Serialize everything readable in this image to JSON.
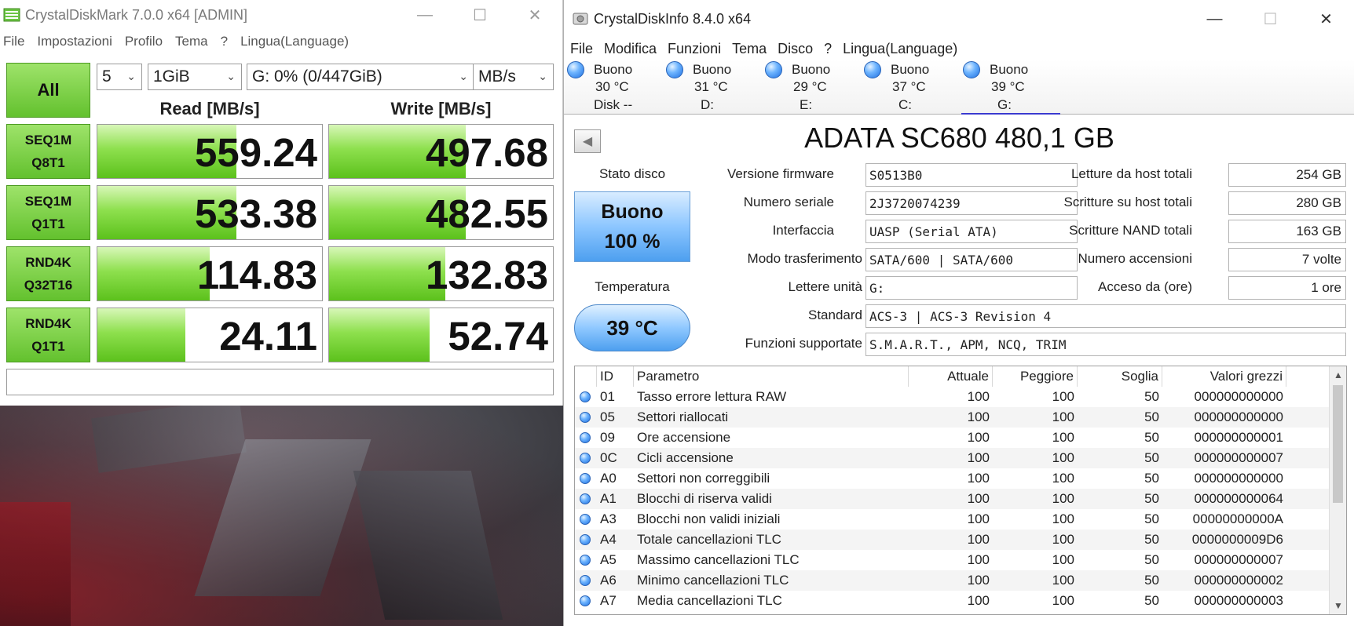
{
  "cdm": {
    "title": "CrystalDiskMark 7.0.0 x64 [ADMIN]",
    "menu": [
      "File",
      "Impostazioni",
      "Profilo",
      "Tema",
      "?",
      "Lingua(Language)"
    ],
    "all_label": "All",
    "count": "5",
    "size": "1GiB",
    "drive": "G: 0% (0/447GiB)",
    "unit": "MB/s",
    "read_header": "Read [MB/s]",
    "write_header": "Write [MB/s]",
    "tests": [
      {
        "l1": "SEQ1M",
        "l2": "Q8T1",
        "read": "559.24",
        "write": "497.68",
        "read_fill": 0.62,
        "write_fill": 0.61
      },
      {
        "l1": "SEQ1M",
        "l2": "Q1T1",
        "read": "533.38",
        "write": "482.55",
        "read_fill": 0.62,
        "write_fill": 0.61
      },
      {
        "l1": "RND4K",
        "l2": "Q32T16",
        "read": "114.83",
        "write": "132.83",
        "read_fill": 0.5,
        "write_fill": 0.52
      },
      {
        "l1": "RND4K",
        "l2": "Q1T1",
        "read": "24.11",
        "write": "52.74",
        "read_fill": 0.39,
        "write_fill": 0.45
      }
    ]
  },
  "cdi": {
    "title": "CrystalDiskInfo 8.4.0 x64",
    "menu": [
      "File",
      "Modifica",
      "Funzioni",
      "Tema",
      "Disco",
      "?",
      "Lingua(Language)"
    ],
    "disks": [
      {
        "status": "Buono",
        "temp": "30 °C",
        "letter": "Disk --"
      },
      {
        "status": "Buono",
        "temp": "31 °C",
        "letter": "D:"
      },
      {
        "status": "Buono",
        "temp": "29 °C",
        "letter": "E:"
      },
      {
        "status": "Buono",
        "temp": "37 °C",
        "letter": "C:"
      },
      {
        "status": "Buono",
        "temp": "39 °C",
        "letter": "G:"
      }
    ],
    "disk_title": "ADATA SC680 480,1 GB",
    "health_label": "Stato disco",
    "health_status": "Buono",
    "health_percent": "100 %",
    "temp_label": "Temperatura",
    "temp_value": "39 °C",
    "fields": {
      "firmware_label": "Versione firmware",
      "firmware": "S0513B0",
      "serial_label": "Numero seriale",
      "serial": "2J3720074239",
      "interface_label": "Interfaccia",
      "interface": "UASP (Serial ATA)",
      "transfer_label": "Modo trasferimento",
      "transfer": "SATA/600 | SATA/600",
      "drive_label": "Lettere unità",
      "drive": "G:",
      "standard_label": "Standard",
      "standard": "ACS-3 | ACS-3 Revision 4",
      "features_label": "Funzioni supportate",
      "features": "S.M.A.R.T., APM, NCQ, TRIM",
      "reads_label": "Letture da host totali",
      "reads": "254 GB",
      "writes_label": "Scritture su host totali",
      "writes": "280 GB",
      "nand_label": "Scritture NAND totali",
      "nand": "163 GB",
      "poweron_count_label": "Numero accensioni",
      "poweron_count": "7 volte",
      "poweron_hours_label": "Acceso da (ore)",
      "poweron_hours": "1 ore"
    },
    "smart_headers": [
      "ID",
      "Parametro",
      "Attuale",
      "Peggiore",
      "Soglia",
      "Valori grezzi"
    ],
    "smart_rows": [
      {
        "id": "01",
        "name": "Tasso errore lettura RAW",
        "cur": "100",
        "worst": "100",
        "thr": "50",
        "raw": "000000000000"
      },
      {
        "id": "05",
        "name": "Settori riallocati",
        "cur": "100",
        "worst": "100",
        "thr": "50",
        "raw": "000000000000"
      },
      {
        "id": "09",
        "name": "Ore accensione",
        "cur": "100",
        "worst": "100",
        "thr": "50",
        "raw": "000000000001"
      },
      {
        "id": "0C",
        "name": "Cicli accensione",
        "cur": "100",
        "worst": "100",
        "thr": "50",
        "raw": "000000000007"
      },
      {
        "id": "A0",
        "name": "Settori non correggibili",
        "cur": "100",
        "worst": "100",
        "thr": "50",
        "raw": "000000000000"
      },
      {
        "id": "A1",
        "name": "Blocchi di riserva validi",
        "cur": "100",
        "worst": "100",
        "thr": "50",
        "raw": "000000000064"
      },
      {
        "id": "A3",
        "name": "Blocchi non validi iniziali",
        "cur": "100",
        "worst": "100",
        "thr": "50",
        "raw": "00000000000A"
      },
      {
        "id": "A4",
        "name": "Totale cancellazioni TLC",
        "cur": "100",
        "worst": "100",
        "thr": "50",
        "raw": "0000000009D6"
      },
      {
        "id": "A5",
        "name": "Massimo cancellazioni TLC",
        "cur": "100",
        "worst": "100",
        "thr": "50",
        "raw": "000000000007"
      },
      {
        "id": "A6",
        "name": "Minimo cancellazioni TLC",
        "cur": "100",
        "worst": "100",
        "thr": "50",
        "raw": "000000000002"
      },
      {
        "id": "A7",
        "name": "Media cancellazioni TLC",
        "cur": "100",
        "worst": "100",
        "thr": "50",
        "raw": "000000000003"
      }
    ]
  }
}
